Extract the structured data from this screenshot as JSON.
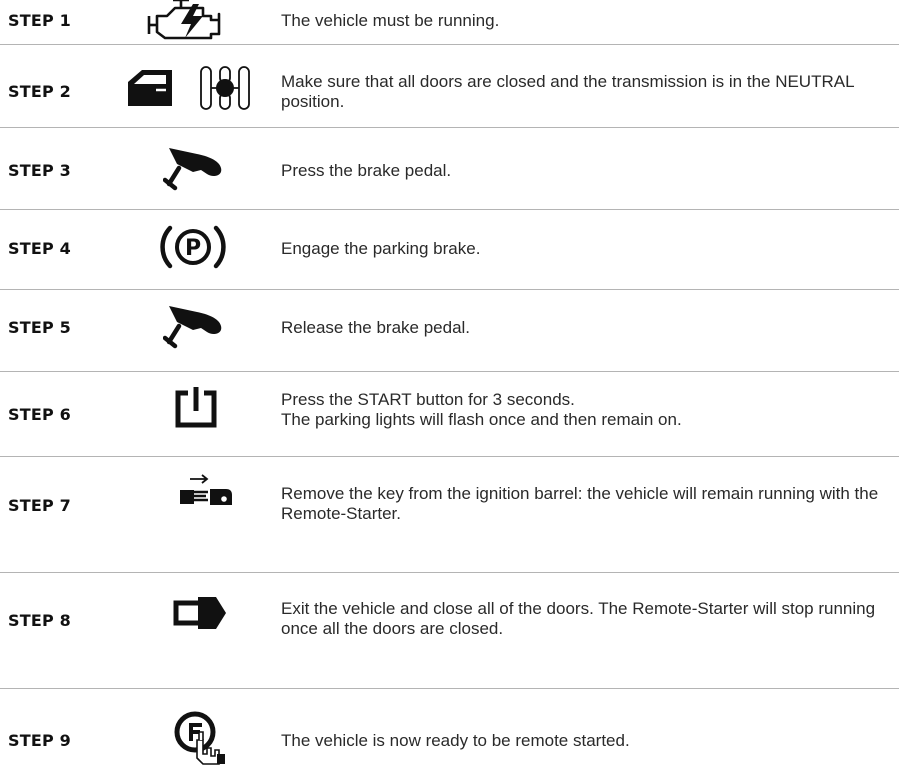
{
  "steps": [
    {
      "label": "STEP 1",
      "text": "The vehicle must be running.",
      "icons": [
        "engine-check-icon"
      ]
    },
    {
      "label": "STEP 2",
      "text": "Make sure that all doors are closed and the  transmission is in the NEUTRAL position.",
      "icons": [
        "car-door-icon",
        "gear-shift-neutral-icon"
      ]
    },
    {
      "label": "STEP 3",
      "text": "Press the brake pedal.",
      "icons": [
        "brake-pedal-press-icon"
      ]
    },
    {
      "label": "STEP 4",
      "text": "Engage the parking brake.",
      "icons": [
        "parking-brake-icon"
      ]
    },
    {
      "label": "STEP 5",
      "text": "Release the brake pedal.",
      "icons": [
        "brake-pedal-release-icon"
      ]
    },
    {
      "label": "STEP 6",
      "text_lines": [
        "Press the START button for 3 seconds.",
        "The parking lights will flash once and then remain on."
      ],
      "icons": [
        "start-button-icon"
      ]
    },
    {
      "label": "STEP 7",
      "text": "Remove the key from the ignition barrel: the vehicle will remain running with the Remote-Starter.",
      "icons": [
        "key-removal-icon"
      ]
    },
    {
      "label": "STEP 8",
      "text": "Exit the vehicle and close all of the doors. The Remote-Starter will stop running once all the doors are closed.",
      "icons": [
        "exit-vehicle-icon"
      ]
    },
    {
      "label": "STEP 9",
      "text": "The vehicle is now ready to be remote started.",
      "icons": [
        "remote-button-icon"
      ]
    }
  ],
  "icon_glyphs": {
    "parking_brake": "P"
  }
}
